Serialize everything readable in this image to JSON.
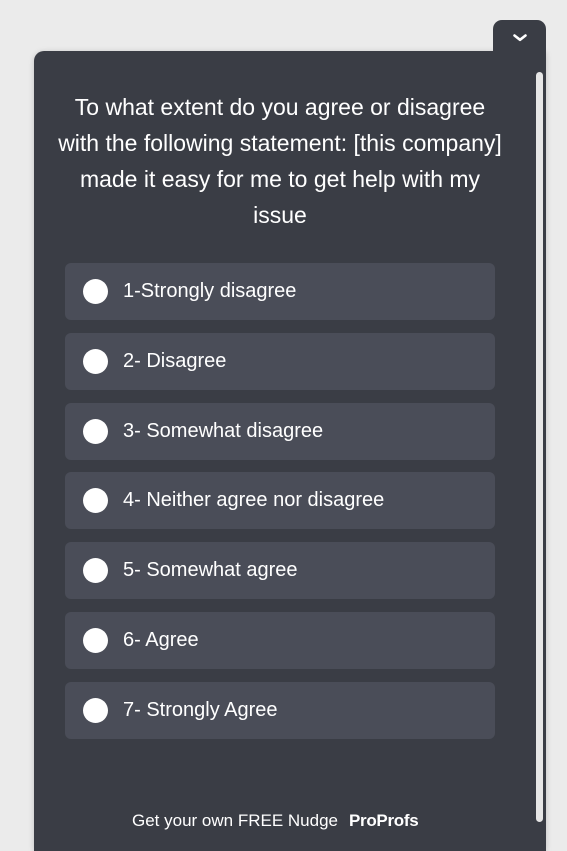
{
  "survey": {
    "question": "To what extent do you agree or disagree with the following statement: [this company] made it easy for me to get help with my issue",
    "options": [
      {
        "label": "1-Strongly disagree"
      },
      {
        "label": "2- Disagree"
      },
      {
        "label": "3- Somewhat disagree"
      },
      {
        "label": "4- Neither agree nor disagree"
      },
      {
        "label": "5- Somewhat agree"
      },
      {
        "label": "6- Agree"
      },
      {
        "label": "7- Strongly Agree"
      }
    ]
  },
  "footer": {
    "text": "Get your own FREE Nudge",
    "brand": "ProProfs"
  },
  "icons": {
    "collapse": "chevron-down-icon"
  },
  "colors": {
    "panel_bg": "#3a3d45",
    "option_bg": "#4a4d58",
    "text": "#ffffff",
    "page_bg": "#ebebeb"
  }
}
